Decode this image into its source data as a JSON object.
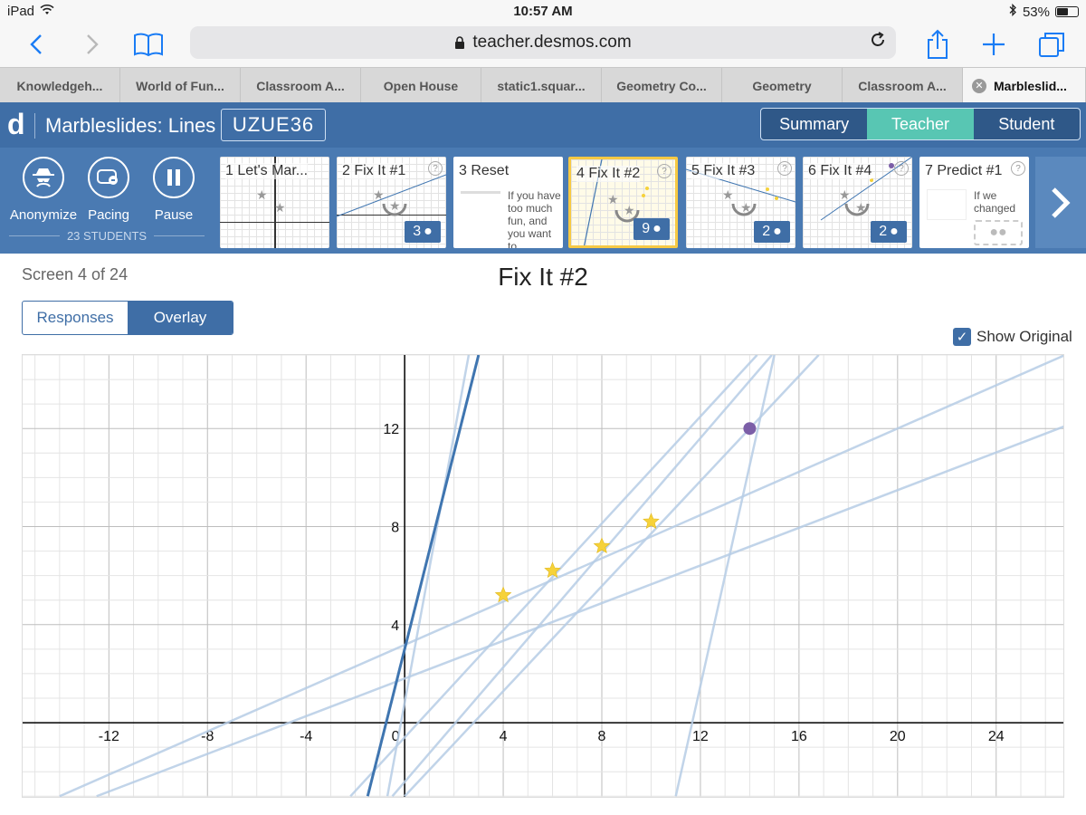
{
  "status": {
    "device": "iPad",
    "time": "10:57 AM",
    "battery": "53%",
    "battery_level": 0.53
  },
  "browser": {
    "url": "teacher.desmos.com"
  },
  "tabs": [
    {
      "label": "Knowledgeh..."
    },
    {
      "label": "World of Fun..."
    },
    {
      "label": "Classroom A..."
    },
    {
      "label": "Open House"
    },
    {
      "label": "static1.squar..."
    },
    {
      "label": "Geometry Co..."
    },
    {
      "label": "Geometry"
    },
    {
      "label": "Classroom A..."
    },
    {
      "label": "Marbleslid..."
    }
  ],
  "header": {
    "logo": "d",
    "title": "Marbleslides: Lines",
    "code": "UZUE36",
    "views": [
      "Summary",
      "Teacher",
      "Student"
    ],
    "active_view": "Teacher"
  },
  "controls": {
    "anonymize": "Anonymize",
    "pacing": "Pacing",
    "pause": "Pause",
    "students": "23 STUDENTS"
  },
  "screens": [
    {
      "title": "1 Let's Mar...",
      "badge": ""
    },
    {
      "title": "2 Fix It #1",
      "badge": "3"
    },
    {
      "title": "3 Reset",
      "badge": "",
      "text": "If you have too much fun, and you want to"
    },
    {
      "title": "4 Fix It #2",
      "badge": "9"
    },
    {
      "title": "5 Fix It #3",
      "badge": "2"
    },
    {
      "title": "6 Fix It #4",
      "badge": "2"
    },
    {
      "title": "7 Predict #1",
      "badge": "",
      "text": "If we changed"
    }
  ],
  "main": {
    "screen_of": "Screen 4 of 24",
    "title": "Fix It #2",
    "mode_tabs": [
      "Responses",
      "Overlay"
    ],
    "active_mode": "Overlay",
    "show_original": "Show Original"
  },
  "chart_data": {
    "type": "line",
    "xlim": [
      -15.5,
      26.8
    ],
    "ylim": [
      -3.1,
      15
    ],
    "x_ticks": [
      -12,
      -8,
      -4,
      0,
      4,
      8,
      12,
      16,
      20,
      24
    ],
    "y_ticks": [
      4,
      8,
      12
    ],
    "grid": true,
    "original_line": {
      "points": [
        [
          -1.5,
          -3
        ],
        [
          3,
          15
        ]
      ]
    },
    "student_lines": [
      {
        "points": [
          [
            -14,
            -3
          ],
          [
            26.8,
            15
          ]
        ]
      },
      {
        "points": [
          [
            -12.5,
            -3
          ],
          [
            26.8,
            12.1
          ]
        ]
      },
      {
        "points": [
          [
            -0.5,
            -3
          ],
          [
            14.9,
            15
          ]
        ]
      },
      {
        "points": [
          [
            -0.7,
            -3
          ],
          [
            2.6,
            15
          ]
        ]
      },
      {
        "points": [
          [
            -2.2,
            -3
          ],
          [
            14.3,
            15
          ]
        ]
      },
      {
        "points": [
          [
            0,
            -3
          ],
          [
            16.8,
            15
          ]
        ]
      },
      {
        "points": [
          [
            11,
            -3
          ],
          [
            15,
            15
          ]
        ]
      }
    ],
    "stars": [
      [
        4,
        5.2
      ],
      [
        6,
        6.2
      ],
      [
        8,
        7.2
      ],
      [
        10,
        8.2
      ]
    ],
    "marble": [
      14,
      12
    ],
    "colors": {
      "original": "#3f75b0",
      "student": "#b6cde5",
      "star": "#f6d23a",
      "marble": "#7b5ea7",
      "axis": "#000"
    }
  }
}
